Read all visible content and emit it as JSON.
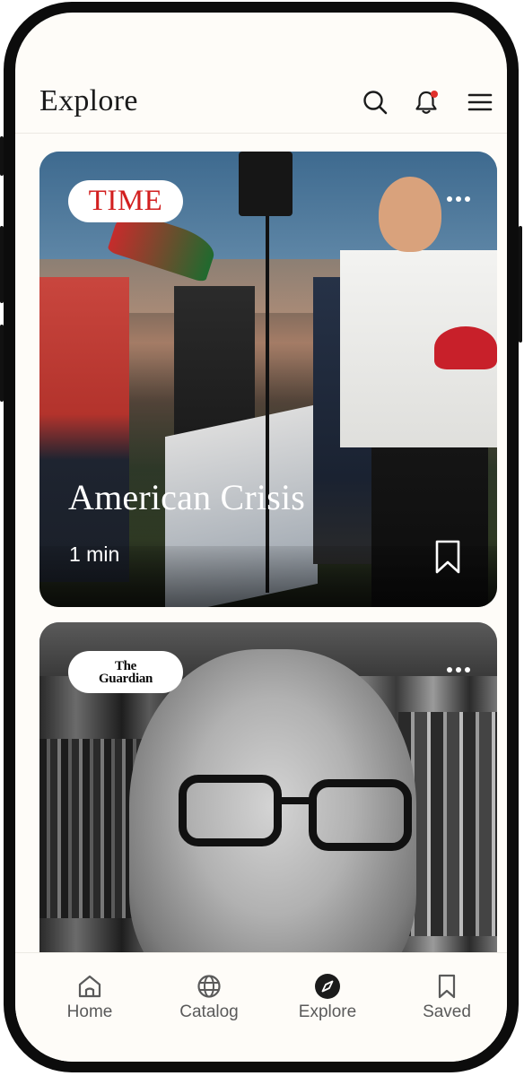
{
  "header": {
    "title": "Explore",
    "icons": [
      "search-icon",
      "bell-icon",
      "menu-icon"
    ],
    "notification_dot_color": "#e0302b"
  },
  "feed": {
    "cards": [
      {
        "source": "TIME",
        "source_color": "#d21f1f",
        "title": "American Crisis",
        "read_time": "1 min",
        "actions": [
          "more-icon",
          "bookmark-icon"
        ]
      },
      {
        "source_line1": "The",
        "source_line2": "Guardian",
        "actions": [
          "more-icon"
        ]
      }
    ]
  },
  "bottom_nav": {
    "items": [
      {
        "label": "Home",
        "icon": "home-icon"
      },
      {
        "label": "Catalog",
        "icon": "globe-icon"
      },
      {
        "label": "Explore",
        "icon": "compass-icon",
        "active": true
      },
      {
        "label": "Saved",
        "icon": "bookmark-icon"
      }
    ]
  }
}
